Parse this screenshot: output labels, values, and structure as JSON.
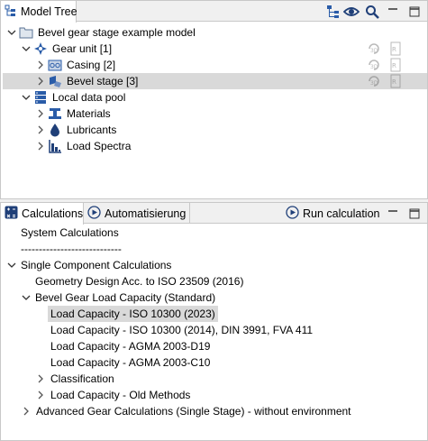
{
  "model_tree": {
    "tab_title": "Model Tree",
    "nodes": [
      {
        "label": "Bevel gear stage example model",
        "icon": "folder-icon"
      },
      {
        "label": "Gear unit [1]",
        "icon": "gear-unit-icon"
      },
      {
        "label": "Casing [2]",
        "icon": "casing-icon"
      },
      {
        "label": "Bevel stage [3]",
        "icon": "bevel-gear-icon"
      },
      {
        "label": "Local data pool",
        "icon": "database-icon"
      },
      {
        "label": "Materials",
        "icon": "materials-icon"
      },
      {
        "label": "Lubricants",
        "icon": "lubricant-drop-icon"
      },
      {
        "label": "Load Spectra",
        "icon": "load-spectra-icon"
      }
    ]
  },
  "calculations": {
    "tab_calculations": "Calculations",
    "tab_automation": "Automatisierung",
    "run_label": "Run calculation",
    "items": [
      "System Calculations",
      "----------------------------",
      "Single Component Calculations",
      "Geometry Design Acc. to ISO 23509 (2016)",
      "Bevel Gear Load Capacity (Standard)",
      "Load Capacity - ISO 10300 (2023)",
      "Load Capacity - ISO 10300 (2014), DIN 3991, FVA 411",
      "Load Capacity - AGMA 2003-D19",
      "Load Capacity - AGMA 2003-C10",
      "Classification",
      "Load Capacity - Old Methods",
      "Advanced Gear Calculations (Single Stage) - without environment"
    ]
  },
  "colors": {
    "selection": "#d9d9d9",
    "icon_blue": "#2a5ca8",
    "panel_border": "#c8c8c8"
  }
}
